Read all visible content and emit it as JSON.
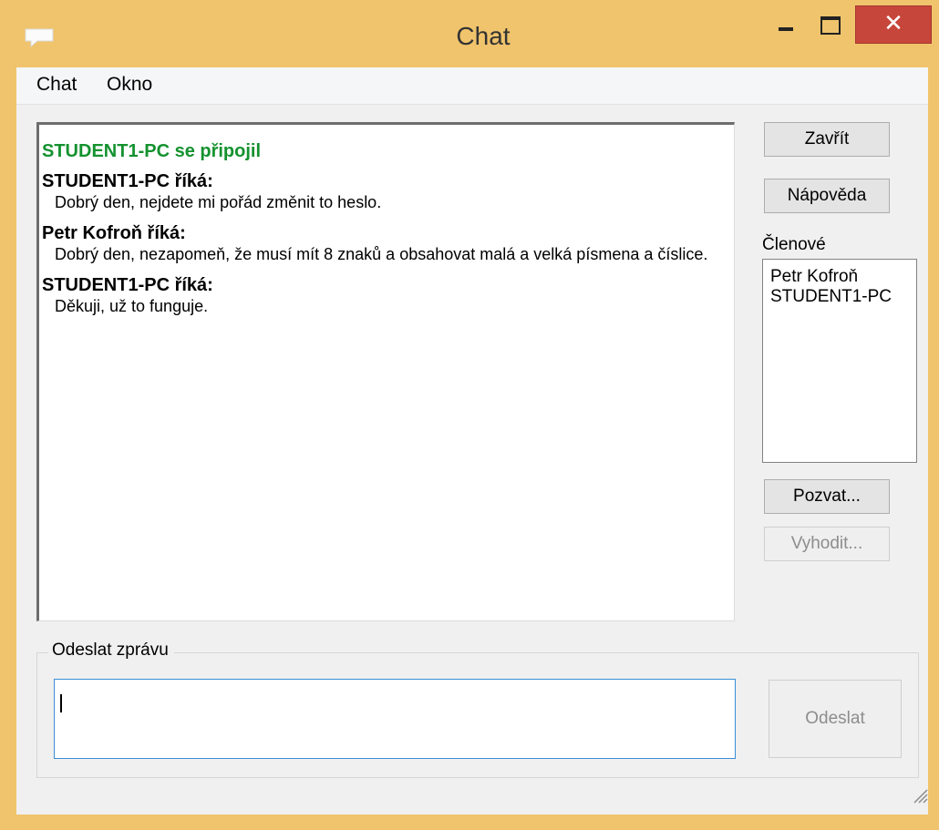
{
  "window": {
    "title": "Chat",
    "close_glyph": "✕",
    "icon": "chat-bubble-icon"
  },
  "menu": [
    {
      "label": "Chat"
    },
    {
      "label": "Okno"
    }
  ],
  "chat_log": {
    "system_message": "STUDENT1-PC se připojil",
    "messages": [
      {
        "sender": "STUDENT1-PC říká:",
        "text": "Dobrý den, nejdete mi pořád změnit to heslo."
      },
      {
        "sender": "Petr Kofroň říká:",
        "text": "Dobrý den, nezapomeň, že musí mít 8 znaků a obsahovat malá a velká písmena a číslice."
      },
      {
        "sender": "STUDENT1-PC říká:",
        "text": "Děkuji, už to funguje."
      }
    ]
  },
  "buttons": {
    "close": "Zavřít",
    "help": "Nápověda",
    "invite": "Pozvat...",
    "kick": "Vyhodit...",
    "send": "Odeslat"
  },
  "members": {
    "label": "Členové",
    "items": [
      "Petr Kofroň",
      "STUDENT1-PC"
    ]
  },
  "compose": {
    "group_label": "Odeslat zprávu",
    "value": ""
  },
  "colors": {
    "titlebar": "#f0c46c",
    "system_message": "#14922f",
    "close_button": "#c7463b",
    "input_focus": "#3c8ed8"
  }
}
